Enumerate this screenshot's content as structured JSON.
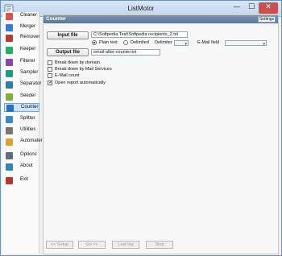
{
  "window": {
    "title": "ListMotor",
    "minimize": "—",
    "maximize": "☐",
    "close": "✕"
  },
  "sidebar": {
    "items": [
      {
        "label": "Cleaner",
        "icon": "broom-icon",
        "color": "#d9534f"
      },
      {
        "label": "Merger",
        "icon": "merge-icon",
        "color": "#3a7bd5"
      },
      {
        "label": "Remover",
        "icon": "remove-icon",
        "color": "#c0392b"
      },
      {
        "label": "Keeper",
        "icon": "keep-icon",
        "color": "#27ae60"
      },
      {
        "label": "Filterer",
        "icon": "filter-icon",
        "color": "#8e44ad"
      },
      {
        "label": "Sampler",
        "icon": "sample-icon",
        "color": "#16a085"
      },
      {
        "label": "Separator",
        "icon": "separate-icon",
        "color": "#2980b9"
      },
      {
        "label": "Seeder",
        "icon": "seed-icon",
        "color": "#7fb03a"
      },
      {
        "label": "Counter",
        "icon": "counter-icon",
        "color": "#2c6fbb"
      },
      {
        "label": "Splitter",
        "icon": "split-icon",
        "color": "#3c8dbc"
      },
      {
        "label": "Utilities",
        "icon": "tools-icon",
        "color": "#777777"
      },
      {
        "label": "Automater",
        "icon": "automate-icon",
        "color": "#e0a030"
      },
      {
        "label": "Options",
        "icon": "options-icon",
        "color": "#5d6d7e"
      },
      {
        "label": "About",
        "icon": "about-icon",
        "color": "#2e86c1"
      },
      {
        "label": "Exit",
        "icon": "exit-icon",
        "color": "#b03a2e"
      }
    ]
  },
  "panel": {
    "title": "Counter",
    "settings_label": "Settings",
    "input_file_label": "Input file",
    "input_file_value": "C:\\Softpedia Test\\Softpedia recipients_2.txt",
    "plain_text_label": "Plain text",
    "delimited_label": "Delimited",
    "delimiter_label": "Delimiter",
    "email_field_label": "E-Mail field",
    "output_file_label": "Output file",
    "output_file_value": "email-after-counter.txt",
    "options": [
      {
        "label": "Break down by domain",
        "checked": false
      },
      {
        "label": "Break down by Mail Services",
        "checked": false
      },
      {
        "label": "E-Mail count",
        "checked": false
      },
      {
        "label": "Open report automatically",
        "checked": true
      }
    ]
  },
  "footer": {
    "setup": "<< Setup",
    "go": "Go >>",
    "last_log": "Last log",
    "stop": "Stop"
  }
}
